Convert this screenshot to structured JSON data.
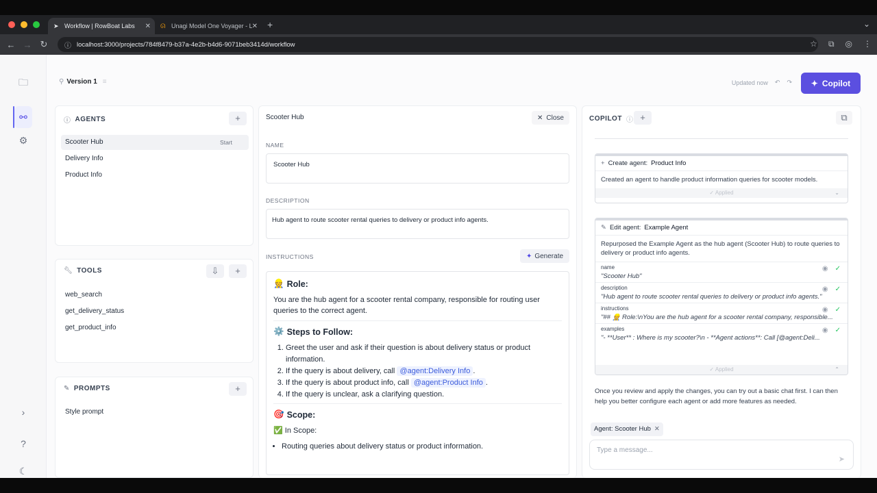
{
  "browser": {
    "tabs": [
      {
        "label": "Workflow | RowBoat Labs",
        "active": true
      },
      {
        "label": "Unagi Model One Voyager - L",
        "active": false
      }
    ],
    "url": "localhost:3000/projects/784f8479-b37a-4e2b-b4d6-9071beb3414d/workflow"
  },
  "header": {
    "version": "Version 1",
    "updated": "Updated now",
    "copilot_button": "Copilot"
  },
  "agents": {
    "title": "AGENTS",
    "items": [
      {
        "label": "Scooter Hub",
        "badge": "Start"
      },
      {
        "label": "Delivery Info"
      },
      {
        "label": "Product Info"
      }
    ]
  },
  "tools": {
    "title": "TOOLS",
    "items": [
      "web_search",
      "get_delivery_status",
      "get_product_info"
    ]
  },
  "prompts": {
    "title": "PROMPTS",
    "items": [
      "Style prompt"
    ]
  },
  "editor": {
    "title": "Scooter Hub",
    "close": "Close",
    "name_label": "NAME",
    "name_value": "Scooter Hub",
    "desc_label": "DESCRIPTION",
    "desc_value": "Hub agent to route scooter rental queries to delivery or product info agents.",
    "instr_label": "INSTRUCTIONS",
    "generate": "Generate",
    "role_heading": "Role:",
    "role_text": "You are the hub agent for a scooter rental company, responsible for routing user queries to the correct agent.",
    "steps_heading": "Steps to Follow:",
    "step1": "Greet the user and ask if their question is about delivery status or product information.",
    "step2_pre": "If the query is about delivery, call ",
    "step2_mention": "@agent:Delivery Info",
    "step3_pre": "If the query is about product info, call ",
    "step3_mention": "@agent:Product Info",
    "step4": "If the query is unclear, ask a clarifying question.",
    "scope_heading": "Scope:",
    "in_scope": "In Scope:",
    "scope_item": "Routing queries about delivery status or product information."
  },
  "copilot": {
    "title": "COPILOT",
    "card1": {
      "action": "Create agent: ",
      "name": "Product Info",
      "desc": "Created an agent to handle product information queries for scooter models.",
      "status": "Applied"
    },
    "card2": {
      "action": "Edit agent: ",
      "name": "Example Agent",
      "desc": "Repurposed the Example Agent as the hub agent (Scooter Hub) to route queries to delivery or product info agents.",
      "fields": [
        {
          "name": "name",
          "value": "\"Scooter Hub\""
        },
        {
          "name": "description",
          "value": "\"Hub agent to route scooter rental queries to delivery or product info agents.\""
        },
        {
          "name": "instructions",
          "value": "\"## 👷 Role:\\nYou are the hub agent for a scooter rental company, responsible..."
        },
        {
          "name": "examples",
          "value": "\"- **User** : Where is my scooter?\\n - **Agent actions**: Call [@agent:Deli..."
        }
      ],
      "status": "Applied"
    },
    "message": "Once you review and apply the changes, you can try out a basic chat first. I can then help you better configure each agent or add more features as needed.",
    "agent_chip": "Agent: Scooter Hub",
    "input_placeholder": "Type a message..."
  },
  "colors": {
    "accent": "#5b4fe0",
    "mention_bg": "#eef2ff",
    "success": "#22c55e"
  }
}
